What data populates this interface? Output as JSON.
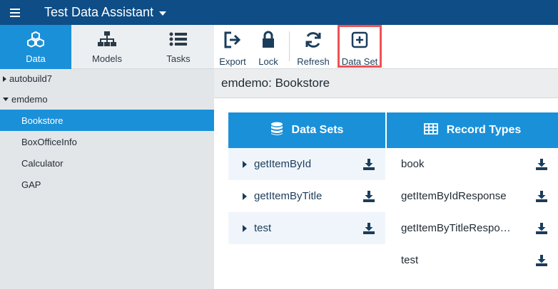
{
  "app": {
    "title": "Test Data Assistant"
  },
  "nav_tabs": [
    {
      "label": "Data",
      "icon": "cubes-icon",
      "active": true
    },
    {
      "label": "Models",
      "icon": "sitemap-icon",
      "active": false
    },
    {
      "label": "Tasks",
      "icon": "list-icon",
      "active": false
    }
  ],
  "toolbar": {
    "export_label": "Export",
    "lock_label": "Lock",
    "refresh_label": "Refresh",
    "dataset_label": "Data Set"
  },
  "tree": [
    {
      "label": "autobuild7",
      "type": "root",
      "expanded": false
    },
    {
      "label": "emdemo",
      "type": "root",
      "expanded": true
    },
    {
      "label": "Bookstore",
      "type": "child",
      "selected": true
    },
    {
      "label": "BoxOfficeInfo",
      "type": "child"
    },
    {
      "label": "Calculator",
      "type": "child"
    },
    {
      "label": "GAP",
      "type": "child"
    }
  ],
  "main": {
    "header": "emdemo: Bookstore"
  },
  "data_sets": {
    "title": "Data Sets",
    "items": [
      "getItemById",
      "getItemByTitle",
      "test"
    ]
  },
  "record_types": {
    "title": "Record Types",
    "items": [
      "book",
      "getItemByIdResponse",
      "getItemByTitleRespo…",
      "test"
    ]
  },
  "colors": {
    "appbar": "#0e4d86",
    "accent": "#1a90d9",
    "highlight": "#f05252"
  }
}
